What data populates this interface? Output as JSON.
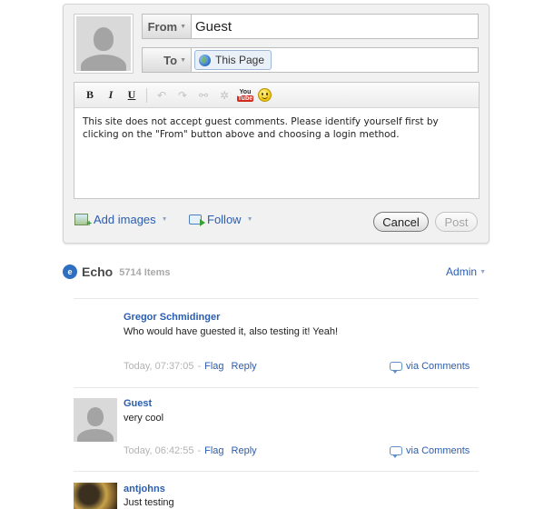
{
  "composer": {
    "from_label": "From",
    "from_value": "Guest",
    "to_label": "To",
    "to_value": "This Page",
    "toolbar": {
      "bold": "B",
      "italic": "I",
      "underline": "U",
      "undo": "↶",
      "redo": "↷",
      "link": "⚯",
      "unlink": "✲",
      "youtube_top": "You",
      "youtube_bottom": "Tube"
    },
    "message": "This site does not accept guest comments. Please identify yourself first by clicking on the \"From\" button above and choosing a login method.",
    "add_images_label": "Add images",
    "follow_label": "Follow",
    "cancel_label": "Cancel",
    "post_label": "Post"
  },
  "echo": {
    "title": "Echo",
    "count": "5714 Items",
    "admin_label": "Admin"
  },
  "comments": [
    {
      "author": "Gregor Schmidinger",
      "text": "Who would have guested it, also testing it! Yeah!",
      "timestamp": "Today, 07:37:05",
      "flag": "Flag",
      "reply": "Reply",
      "via": "via Comments"
    },
    {
      "author": "Guest",
      "text": "very cool",
      "timestamp": "Today, 06:42:55",
      "flag": "Flag",
      "reply": "Reply",
      "via": "via Comments"
    },
    {
      "author": "antjohns",
      "text": "Just testing"
    }
  ],
  "colors": {
    "link": "#2a5db0",
    "muted": "#b3b3b3",
    "panel": "#f1f1f1"
  }
}
